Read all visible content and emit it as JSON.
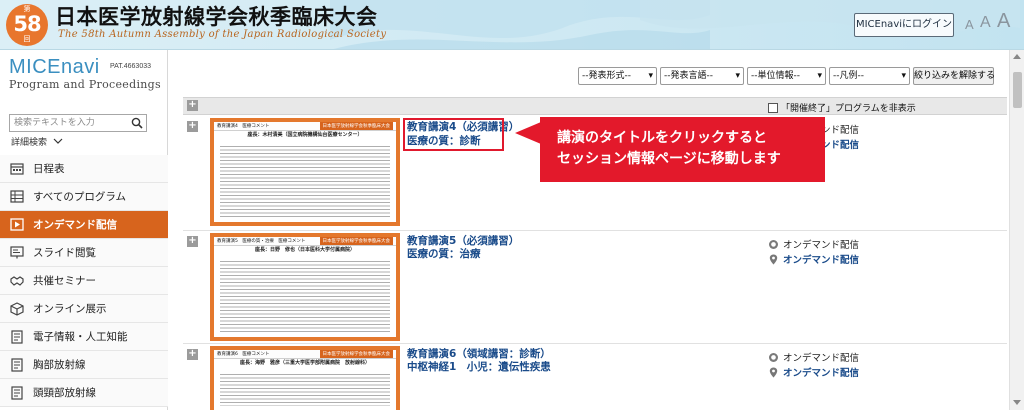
{
  "header": {
    "badge_top": "第",
    "badge_number": "58",
    "badge_bottom": "回",
    "title": "日本医学放射線学会秋季臨床大会",
    "subtitle": "The 58th Autumn Assembly of the Japan Radiological Society",
    "login_label": "MICEnaviにログイン",
    "font_small": "A",
    "font_medium": "A",
    "font_large": "A"
  },
  "sidebar": {
    "logo": "MICEnavi",
    "pat": "PAT.4663033",
    "logo_sub": "Program and Proceedings",
    "search_placeholder": "検索テキストを入力",
    "advanced_search": "詳細検索",
    "items": [
      {
        "label": "日程表",
        "icon": "calendar-icon"
      },
      {
        "label": "すべてのプログラム",
        "icon": "grid-icon"
      },
      {
        "label": "オンデマンド配信",
        "icon": "play-icon"
      },
      {
        "label": "スライド閲覧",
        "icon": "slides-icon"
      },
      {
        "label": "共催セミナー",
        "icon": "handshake-icon"
      },
      {
        "label": "オンライン展示",
        "icon": "cube-icon"
      },
      {
        "label": "電子情報・人工知能",
        "icon": "document-icon"
      },
      {
        "label": "胸部放射線",
        "icon": "document-icon"
      },
      {
        "label": "頭頸部放射線",
        "icon": "document-icon"
      }
    ],
    "active_index": 2
  },
  "filters": {
    "format": "--発表形式--",
    "language": "--発表言語--",
    "credit": "--単位情報--",
    "legend": "--凡例--",
    "clear_label": "絞り込みを解除する"
  },
  "table": {
    "hide_ended_label": "「開催終了」プログラムを非表示"
  },
  "rows": [
    {
      "thumb_tag": "教育講演4　医療コメント",
      "thumb_ribbon": "日本医学放射線学会秋季臨床大会",
      "thumb_title": "座長：木村清美（国立病院機構仙台医療センター）",
      "title": "教育講演4（必須講習）",
      "subtitle": "医療の質：診断",
      "status": "オンデマンド配信",
      "location": "オンデマンド配信"
    },
    {
      "thumb_tag": "教育講演5　医療の質・治療　医療コメント",
      "thumb_ribbon": "日本医学放射線学会秋季臨床大会",
      "thumb_title": "座長：日野　修也（日本医科大学付属病院）",
      "title": "教育講演5（必須講習）",
      "subtitle": "医療の質：治療",
      "status": "オンデマンド配信",
      "location": "オンデマンド配信"
    },
    {
      "thumb_tag": "教育講演6　医療コメント",
      "thumb_ribbon": "日本医学放射線学会秋季臨床大会",
      "thumb_title": "座長：海野　雅彦（三重大学医学部附属病院　放射線科）",
      "title": "教育講演6（領域講習：診断）",
      "subtitle": "中枢神経1　小児：遺伝性疾患",
      "status": "オンデマンド配信",
      "location": "オンデマンド配信"
    }
  ],
  "callout": {
    "line1": "講演のタイトルをクリックすると",
    "line2": "セッション情報ページに移動します"
  },
  "colors": {
    "accent_orange": "#d7641d",
    "link_blue": "#1a4b8a",
    "callout_red": "#e3192b"
  }
}
